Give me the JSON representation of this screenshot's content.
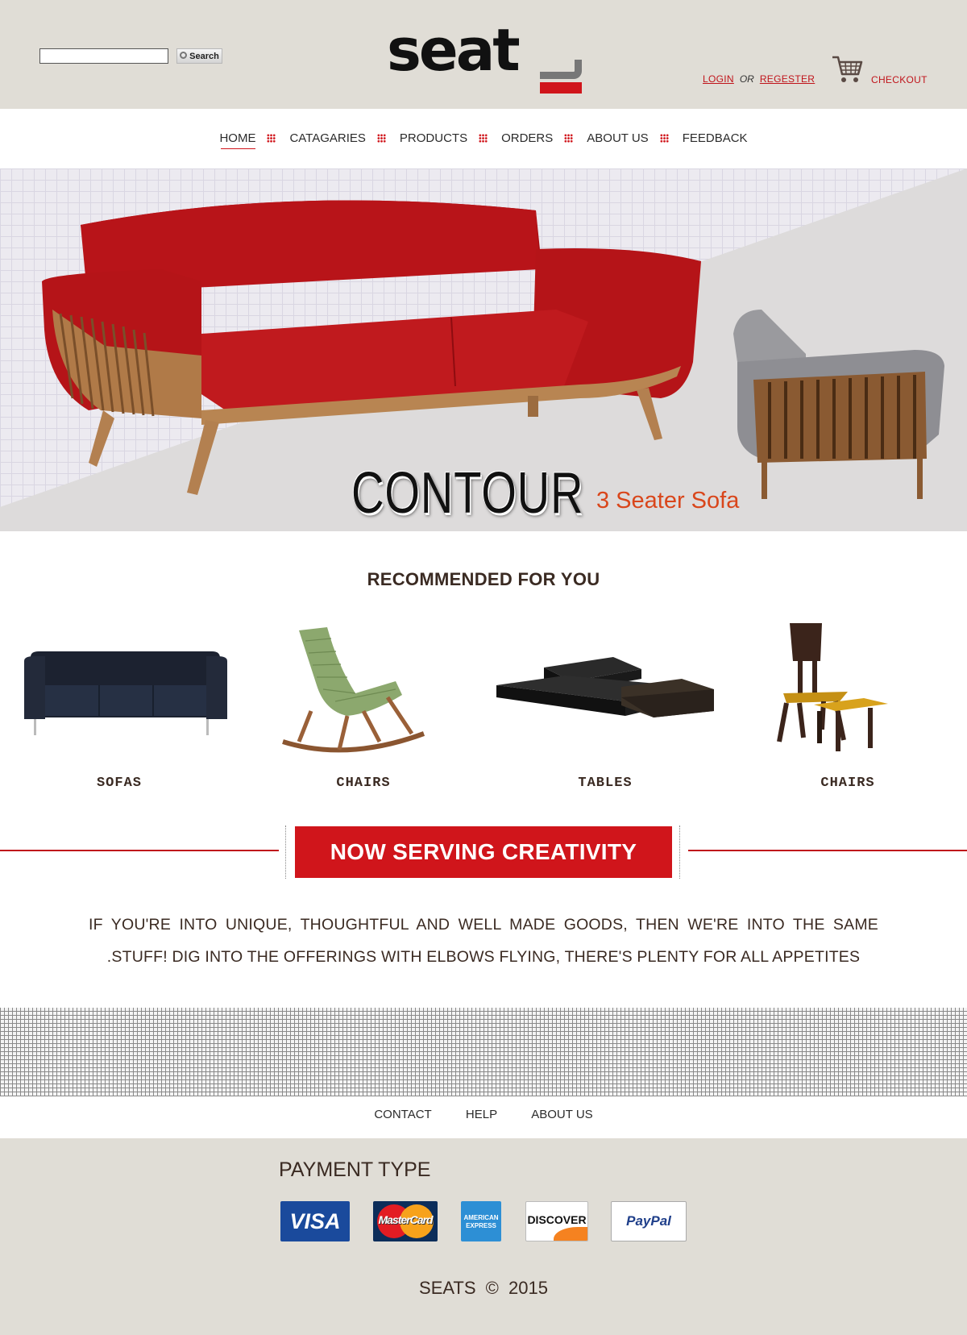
{
  "header": {
    "search_placeholder": "",
    "search_button": "Search",
    "logo_text": "seat",
    "login": "LOGIN",
    "or": "OR",
    "register": "REGESTER",
    "checkout": "CHECKOUT"
  },
  "nav": {
    "items": [
      "HOME",
      "CATAGARIES",
      "PRODUCTS",
      "ORDERS",
      "ABOUT US",
      "FEEDBACK"
    ],
    "active": "HOME"
  },
  "hero": {
    "title": "CONTOUR",
    "subtitle": "3 Seater Sofa"
  },
  "recommended": {
    "title": "RECOMMENDED FOR YOU",
    "items": [
      {
        "label": "SOFAS",
        "icon": "sofa-image"
      },
      {
        "label": "CHAIRS",
        "icon": "rocking-chair-image"
      },
      {
        "label": "TABLES",
        "icon": "coffee-table-image"
      },
      {
        "label": "CHAIRS",
        "icon": "chair-stool-image"
      }
    ]
  },
  "banner": {
    "text": "NOW SERVING CREATIVITY"
  },
  "tagline": "IF YOU'RE INTO UNIQUE, THOUGHTFUL AND WELL MADE GOODS, THEN WE'RE INTO THE SAME .STUFF! DIG INTO THE OFFERINGS WITH ELBOWS FLYING, THERE'S PLENTY FOR ALL APPETITES",
  "footer_links": [
    "CONTACT",
    "HELP",
    "ABOUT US"
  ],
  "footer": {
    "payment_title": "PAYMENT TYPE",
    "payment_methods": [
      "VISA",
      "MasterCard",
      "AMERICAN EXPRESS",
      "DISCOVER",
      "PayPal"
    ],
    "copyright": "SEATS © 2015"
  },
  "colors": {
    "accent_red": "#d0151b",
    "header_bg": "#e0ddd6",
    "text_brown": "#3a2a22"
  }
}
